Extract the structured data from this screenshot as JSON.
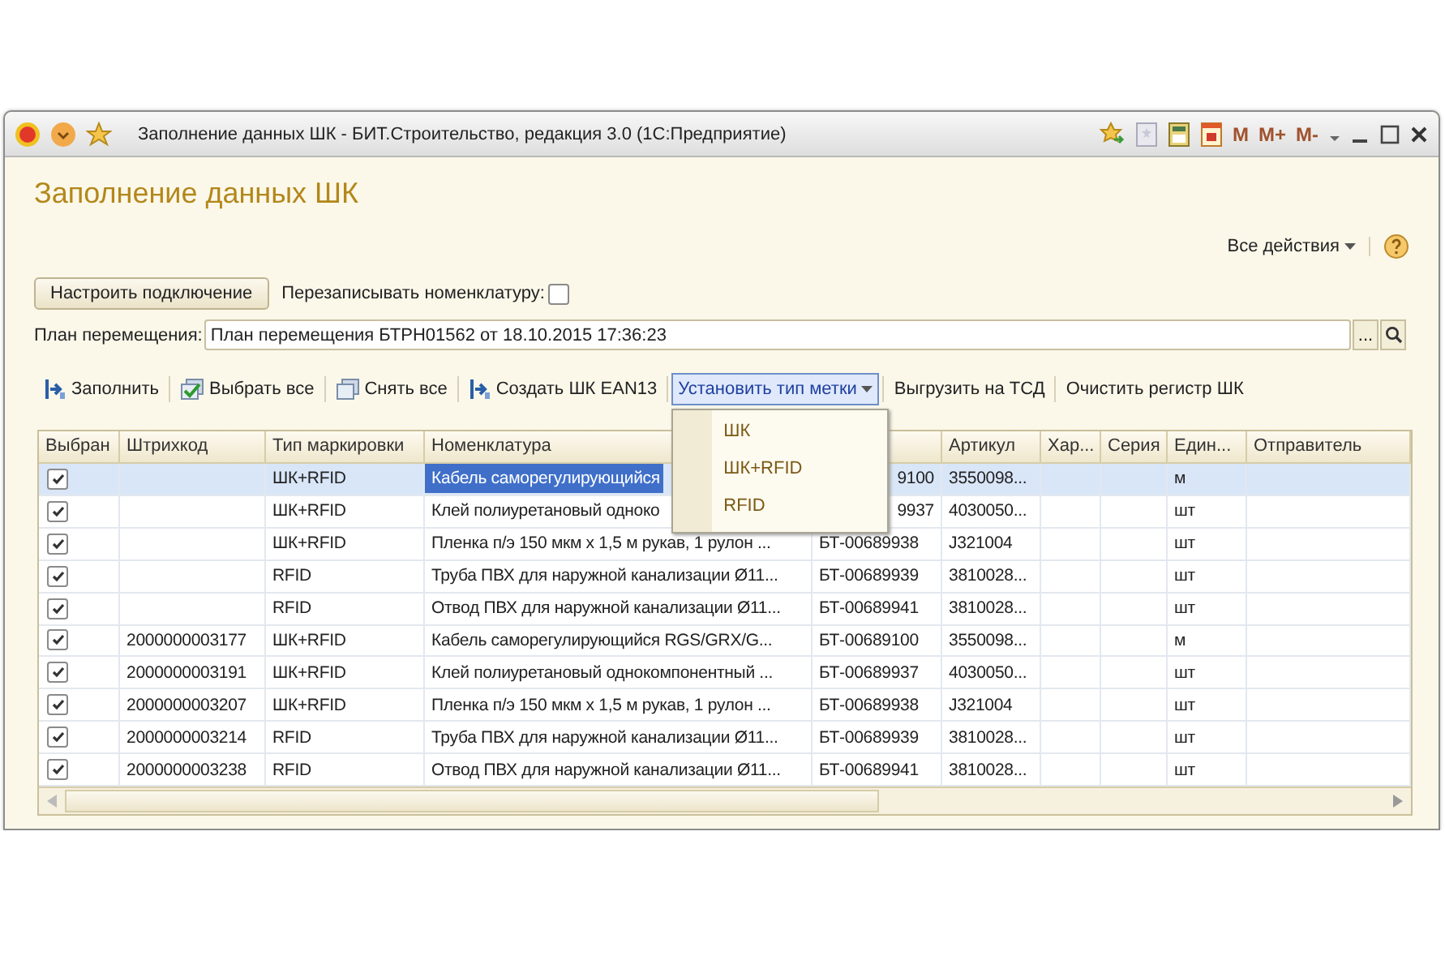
{
  "window": {
    "title": "Заполнение данных ШК - БИТ.Строительство, редакция 3.0  (1С:Предприятие)",
    "memory_buttons": [
      "M",
      "M+",
      "M-"
    ]
  },
  "form_title": "Заполнение данных ШК",
  "all_actions": "Все действия",
  "connect_button": "Настроить подключение",
  "overwrite": {
    "label": "Перезаписывать номенклатуру:",
    "checked": false
  },
  "plan": {
    "label": "План перемещения:",
    "value": "План перемещения БТРН01562 от 18.10.2015 17:36:23",
    "choose_button": "..."
  },
  "commands": [
    {
      "label": "Заполнить",
      "kind": "arrow",
      "menu": false,
      "active": false
    },
    {
      "label": "Выбрать все",
      "kind": "check",
      "menu": false,
      "active": false
    },
    {
      "label": "Снять все",
      "kind": "stack",
      "menu": false,
      "active": false
    },
    {
      "label": "Создать ШК EAN13",
      "kind": "arrow",
      "menu": false,
      "active": false
    },
    {
      "label": "Установить тип метки",
      "kind": "plain",
      "menu": true,
      "active": true
    },
    {
      "label": "Выгрузить на ТСД",
      "kind": "plain",
      "menu": false,
      "active": false
    },
    {
      "label": "Очистить регистр ШК",
      "kind": "plain",
      "menu": false,
      "active": false
    }
  ],
  "menu_items": [
    "ШК",
    "ШК+RFID",
    "RFID"
  ],
  "columns": [
    "Выбран",
    "Штрихкод",
    "Тип маркировки",
    "Номенклатура",
    "",
    "Артикул",
    "Хар...",
    "Серия",
    "Един...",
    "Отправитель"
  ],
  "rows": [
    {
      "checked": true,
      "selected": true,
      "under_menu": true,
      "barcode": "",
      "type": "ШК+RFID",
      "name": "Кабель саморегулирующийся",
      "code": "9100",
      "article": "3550098...",
      "unit": "м"
    },
    {
      "checked": true,
      "selected": false,
      "under_menu": true,
      "barcode": "",
      "type": "ШК+RFID",
      "name": "Клей полиуретановый одноко",
      "code": "9937",
      "article": "4030050...",
      "unit": "шт"
    },
    {
      "checked": true,
      "selected": false,
      "under_menu": false,
      "barcode": "",
      "type": "ШК+RFID",
      "name": "Пленка п/э 150 мкм х 1,5 м рукав, 1 рулон ...",
      "code": "БТ-00689938",
      "article": "J321004",
      "unit": "шт"
    },
    {
      "checked": true,
      "selected": false,
      "under_menu": false,
      "barcode": "",
      "type": "RFID",
      "name": "Труба ПВХ для наружной канализации Ø11...",
      "code": "БТ-00689939",
      "article": "3810028...",
      "unit": "шт"
    },
    {
      "checked": true,
      "selected": false,
      "under_menu": false,
      "barcode": "",
      "type": "RFID",
      "name": "Отвод ПВХ для наружной канализации Ø11...",
      "code": "БТ-00689941",
      "article": "3810028...",
      "unit": "шт"
    },
    {
      "checked": true,
      "selected": false,
      "under_menu": false,
      "barcode": "2000000003177",
      "type": "ШК+RFID",
      "name": "Кабель саморегулирующийся RGS/GRX/G...",
      "code": "БТ-00689100",
      "article": "3550098...",
      "unit": "м"
    },
    {
      "checked": true,
      "selected": false,
      "under_menu": false,
      "barcode": "2000000003191",
      "type": "ШК+RFID",
      "name": "Клей полиуретановый однокомпонентный ...",
      "code": "БТ-00689937",
      "article": "4030050...",
      "unit": "шт"
    },
    {
      "checked": true,
      "selected": false,
      "under_menu": false,
      "barcode": "2000000003207",
      "type": "ШК+RFID",
      "name": "Пленка п/э 150 мкм х 1,5 м рукав, 1 рулон ...",
      "code": "БТ-00689938",
      "article": "J321004",
      "unit": "шт"
    },
    {
      "checked": true,
      "selected": false,
      "under_menu": false,
      "barcode": "2000000003214",
      "type": "RFID",
      "name": "Труба ПВХ для наружной канализации Ø11...",
      "code": "БТ-00689939",
      "article": "3810028...",
      "unit": "шт"
    },
    {
      "checked": true,
      "selected": false,
      "under_menu": false,
      "barcode": "2000000003238",
      "type": "RFID",
      "name": "Отвод ПВХ для наружной канализации Ø11...",
      "code": "БТ-00689941",
      "article": "3810028...",
      "unit": "шт"
    }
  ]
}
